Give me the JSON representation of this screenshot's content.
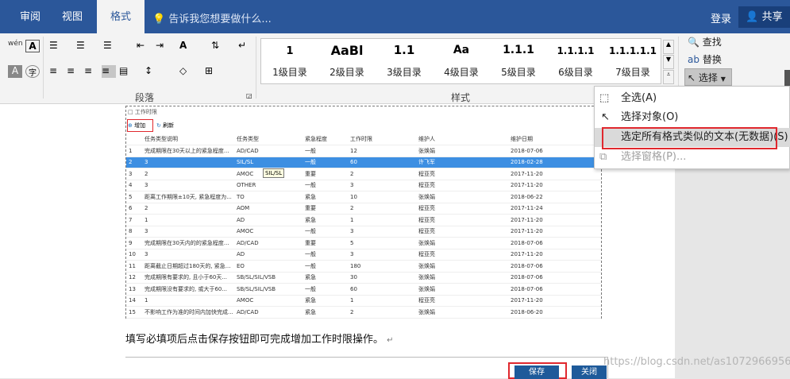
{
  "tabs": [
    "审阅",
    "视图",
    "格式"
  ],
  "tell_me": "告诉我您想要做什么...",
  "login": "登录",
  "share": "共享",
  "groups": {
    "paragraph": "段落",
    "styles": "样式"
  },
  "styles": [
    {
      "sample": "1",
      "name": "1级目录"
    },
    {
      "sample": "AaBl",
      "name": "2级目录"
    },
    {
      "sample": "1.1",
      "name": "3级目录"
    },
    {
      "sample": "Aa",
      "name": "4级目录"
    },
    {
      "sample": "1.1.1",
      "name": "5级目录"
    },
    {
      "sample": "1.1.1.1",
      "name": "6级目录"
    },
    {
      "sample": "1.1.1.1.1",
      "name": "7级目录"
    }
  ],
  "style_names_extra": [
    {
      "name": "1级目录"
    },
    {
      "name": "2级目录"
    },
    {
      "name": "3级目录"
    },
    {
      "name": "4级目录"
    },
    {
      "name": "5级目录"
    },
    {
      "name": "6级目录"
    },
    {
      "name": "7级目录"
    }
  ],
  "editing": {
    "find": "查找",
    "replace": "替换",
    "select": "选择"
  },
  "select_menu": [
    {
      "label": "全选(A)",
      "enabled": true,
      "highlighted": false
    },
    {
      "label": "选择对象(O)",
      "enabled": true,
      "highlighted": false
    },
    {
      "label": "选定所有格式类似的文本(无数据)(S)",
      "enabled": true,
      "highlighted": true
    },
    {
      "label": "选择窗格(P)...",
      "enabled": false,
      "highlighted": false
    }
  ],
  "embedded": {
    "title": "工作时限",
    "add": "增加",
    "refresh": "刷新",
    "tooltip": "SIL/SL",
    "columns": [
      "",
      "任务类型说明",
      "任务类型",
      "紧急程度",
      "工作时限",
      "维护人",
      "维护日期"
    ],
    "rows": [
      [
        "1",
        "完成期限在30天以上的紧急程度...",
        "AD/CAD",
        "一般",
        "12",
        "张焕娟",
        "2018-07-06"
      ],
      [
        "2",
        "3",
        "SIL/SL",
        "一般",
        "60",
        "许飞军",
        "2018-02-28"
      ],
      [
        "3",
        "2",
        "AMOC",
        "重要",
        "2",
        "程亚亮",
        "2017-11-20"
      ],
      [
        "4",
        "3",
        "OTHER",
        "一般",
        "3",
        "程亚亮",
        "2017-11-20"
      ],
      [
        "5",
        "距离工作期限±10天, 紧急程度为...",
        "TO",
        "紧急",
        "10",
        "张焕娟",
        "2018-06-22"
      ],
      [
        "6",
        "2",
        "AOM",
        "重要",
        "2",
        "程亚亮",
        "2017-11-24"
      ],
      [
        "7",
        "1",
        "AD",
        "紧急",
        "1",
        "程亚亮",
        "2017-11-20"
      ],
      [
        "8",
        "3",
        "AMOC",
        "一般",
        "3",
        "程亚亮",
        "2017-11-20"
      ],
      [
        "9",
        "完成期限在30天内的的紧急程度...",
        "AD/CAD",
        "重要",
        "5",
        "张焕娟",
        "2018-07-06"
      ],
      [
        "10",
        "3",
        "AD",
        "一般",
        "3",
        "程亚亮",
        "2017-11-20"
      ],
      [
        "11",
        "距离截止日期超过180天的, 紧急...",
        "EO",
        "一般",
        "180",
        "张焕娟",
        "2018-07-06"
      ],
      [
        "12",
        "完成期限有要求的, 且小于60天...",
        "SB/SL/SIL/VSB",
        "紧急",
        "30",
        "张焕娟",
        "2018-07-06"
      ],
      [
        "13",
        "完成期限没有要求的, 或大于60...",
        "SB/SL/SIL/VSB",
        "一般",
        "60",
        "张焕娟",
        "2018-07-06"
      ],
      [
        "14",
        "1",
        "AMOC",
        "紧急",
        "1",
        "程亚亮",
        "2017-11-20"
      ],
      [
        "15",
        "不影响工作为准的时间内加快完成...",
        "AD/CAD",
        "紧急",
        "2",
        "张焕娟",
        "2018-06-20"
      ]
    ],
    "selected_row": 2
  },
  "doc_text": "填写必填项后点击保存按钮即可完成增加工作时限操作。",
  "bottom_buttons": {
    "save": "保存",
    "close": "关闭"
  },
  "watermark": "https://blog.csdn.net/as1072966956"
}
